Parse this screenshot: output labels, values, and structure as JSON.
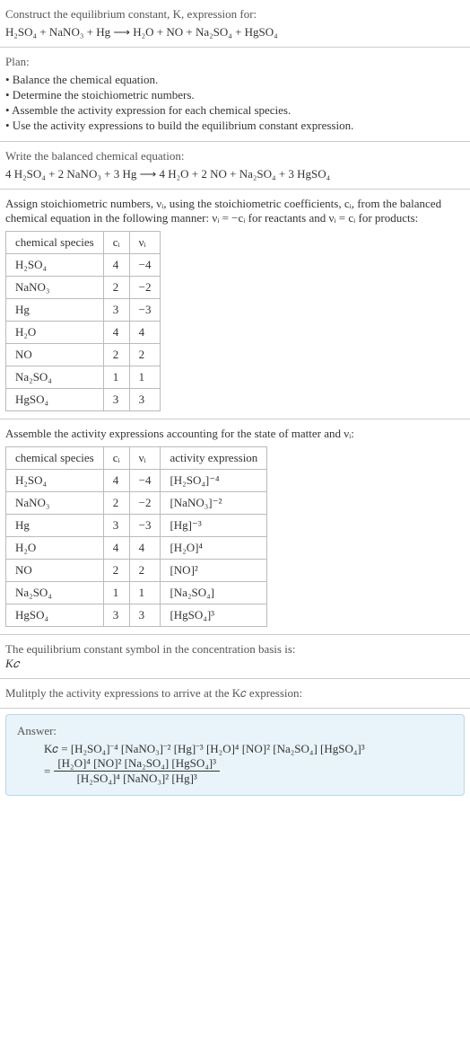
{
  "s1": {
    "title": "Construct the equilibrium constant, K, expression for:",
    "eq": "H₂SO₄ + NaNO₃ + Hg ⟶ H₂O + NO + Na₂SO₄ + HgSO₄"
  },
  "s2": {
    "title": "Plan:",
    "items": [
      "• Balance the chemical equation.",
      "• Determine the stoichiometric numbers.",
      "• Assemble the activity expression for each chemical species.",
      "• Use the activity expressions to build the equilibrium constant expression."
    ]
  },
  "s3": {
    "title": "Write the balanced chemical equation:",
    "eq": "4 H₂SO₄ + 2 NaNO₃ + 3 Hg ⟶ 4 H₂O + 2 NO + Na₂SO₄ + 3 HgSO₄"
  },
  "s4": {
    "intro": "Assign stoichiometric numbers, νᵢ, using the stoichiometric coefficients, cᵢ, from the balanced chemical equation in the following manner: νᵢ = −cᵢ for reactants and νᵢ = cᵢ for products:",
    "headers": [
      "chemical species",
      "cᵢ",
      "νᵢ"
    ],
    "rows": [
      [
        "H₂SO₄",
        "4",
        "−4"
      ],
      [
        "NaNO₃",
        "2",
        "−2"
      ],
      [
        "Hg",
        "3",
        "−3"
      ],
      [
        "H₂O",
        "4",
        "4"
      ],
      [
        "NO",
        "2",
        "2"
      ],
      [
        "Na₂SO₄",
        "1",
        "1"
      ],
      [
        "HgSO₄",
        "3",
        "3"
      ]
    ]
  },
  "s5": {
    "intro": "Assemble the activity expressions accounting for the state of matter and νᵢ:",
    "headers": [
      "chemical species",
      "cᵢ",
      "νᵢ",
      "activity expression"
    ],
    "rows": [
      [
        "H₂SO₄",
        "4",
        "−4",
        "[H₂SO₄]⁻⁴"
      ],
      [
        "NaNO₃",
        "2",
        "−2",
        "[NaNO₃]⁻²"
      ],
      [
        "Hg",
        "3",
        "−3",
        "[Hg]⁻³"
      ],
      [
        "H₂O",
        "4",
        "4",
        "[H₂O]⁴"
      ],
      [
        "NO",
        "2",
        "2",
        "[NO]²"
      ],
      [
        "Na₂SO₄",
        "1",
        "1",
        "[Na₂SO₄]"
      ],
      [
        "HgSO₄",
        "3",
        "3",
        "[HgSO₄]³"
      ]
    ]
  },
  "s6": {
    "title": "The equilibrium constant symbol in the concentration basis is:",
    "sym": "K𝑐"
  },
  "s7": {
    "title": "Mulitply the activity expressions to arrive at the K𝑐 expression:"
  },
  "answer": {
    "label": "Answer:",
    "line1_lhs": "K𝑐 = ",
    "line1_rhs": "[H₂SO₄]⁻⁴ [NaNO₃]⁻² [Hg]⁻³ [H₂O]⁴ [NO]² [Na₂SO₄] [HgSO₄]³",
    "eq2_prefix": "= ",
    "num": "[H₂O]⁴ [NO]² [Na₂SO₄] [HgSO₄]³",
    "den": "[H₂SO₄]⁴ [NaNO₃]² [Hg]³"
  }
}
